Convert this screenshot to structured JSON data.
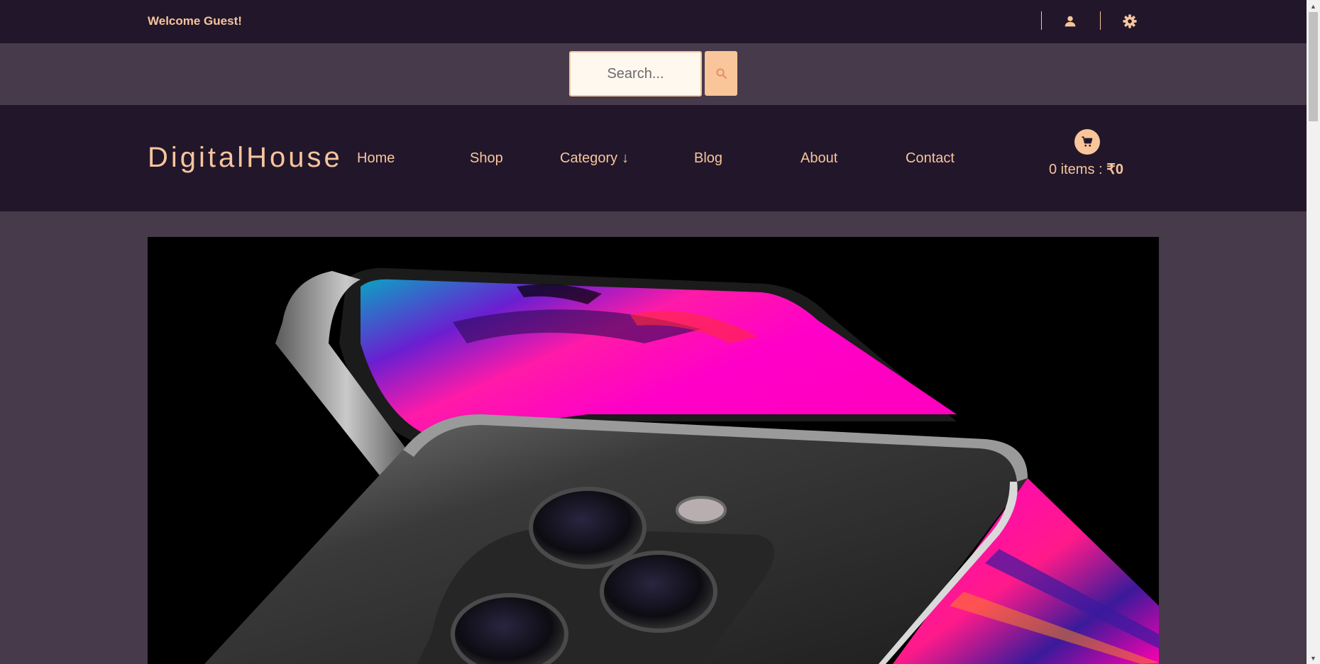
{
  "topbar": {
    "welcome_text": "Welcome Guest!",
    "user_icon": "user-icon",
    "settings_icon": "gear-icon"
  },
  "search": {
    "placeholder": "Search...",
    "button_icon": "search-icon"
  },
  "header": {
    "logo": "DigitalHouse",
    "nav": [
      {
        "label": "Home"
      },
      {
        "label": "Shop"
      },
      {
        "label": "Category",
        "has_dropdown": true,
        "arrow": "↓"
      },
      {
        "label": "Blog"
      },
      {
        "label": "About"
      },
      {
        "label": "Contact"
      }
    ],
    "cart": {
      "icon": "cart-icon",
      "items_text": "0 items : ",
      "total": "₹0"
    }
  },
  "hero": {
    "image": "smartphone-product-photo"
  },
  "colors": {
    "dark_bg": "#22162a",
    "mid_bg": "#463a4b",
    "accent": "#f6c59c",
    "hero_pink": "#ff00c8"
  }
}
